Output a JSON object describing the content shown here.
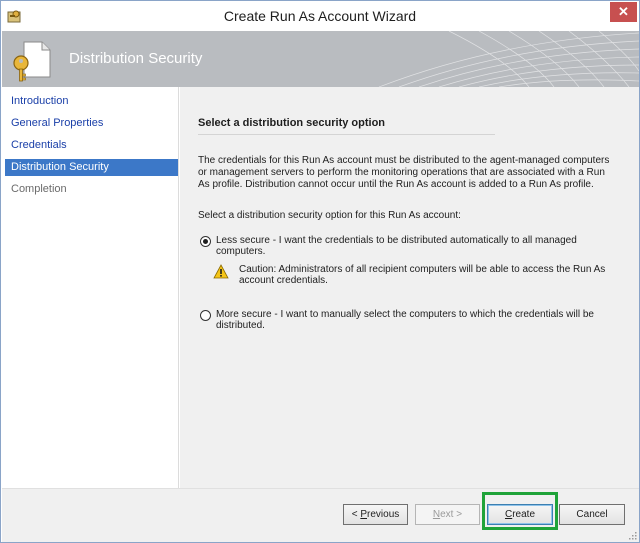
{
  "window": {
    "title": "Create Run As Account Wizard",
    "close_glyph": "✕"
  },
  "banner": {
    "title": "Distribution Security",
    "icon": "key-document-icon"
  },
  "nav": {
    "items": [
      {
        "label": "Introduction",
        "state": "link"
      },
      {
        "label": "General Properties",
        "state": "link"
      },
      {
        "label": "Credentials",
        "state": "link"
      },
      {
        "label": "Distribution Security",
        "state": "active"
      },
      {
        "label": "Completion",
        "state": "disabled"
      }
    ]
  },
  "main": {
    "heading": "Select a distribution security option",
    "description": "The credentials for this Run As account must be distributed to the agent-managed computers or management servers to perform the monitoring operations that are associated with a Run As profile. Distribution cannot occur until the Run As account is added to a Run As profile.",
    "prompt": "Select a distribution security option for this Run As account:",
    "options": [
      {
        "label": "Less secure - I want the credentials to be distributed automatically to all managed computers.",
        "checked": true
      },
      {
        "label": "More secure - I want to manually select the computers to which the credentials will be distributed.",
        "checked": false
      }
    ],
    "caution": "Caution: Administrators of all recipient computers will be able to access the Run As account credentials.",
    "caution_icon": "warning-icon"
  },
  "footer": {
    "previous_prefix": "< ",
    "previous_key": "P",
    "previous_rest": "revious",
    "next_key": "N",
    "next_rest": "ext >",
    "create_key": "C",
    "create_rest": "reate",
    "cancel": "Cancel"
  },
  "colors": {
    "accent": "#3c78c8",
    "banner": "#b9bcc0",
    "highlight": "#1fa339",
    "close": "#c75050"
  }
}
